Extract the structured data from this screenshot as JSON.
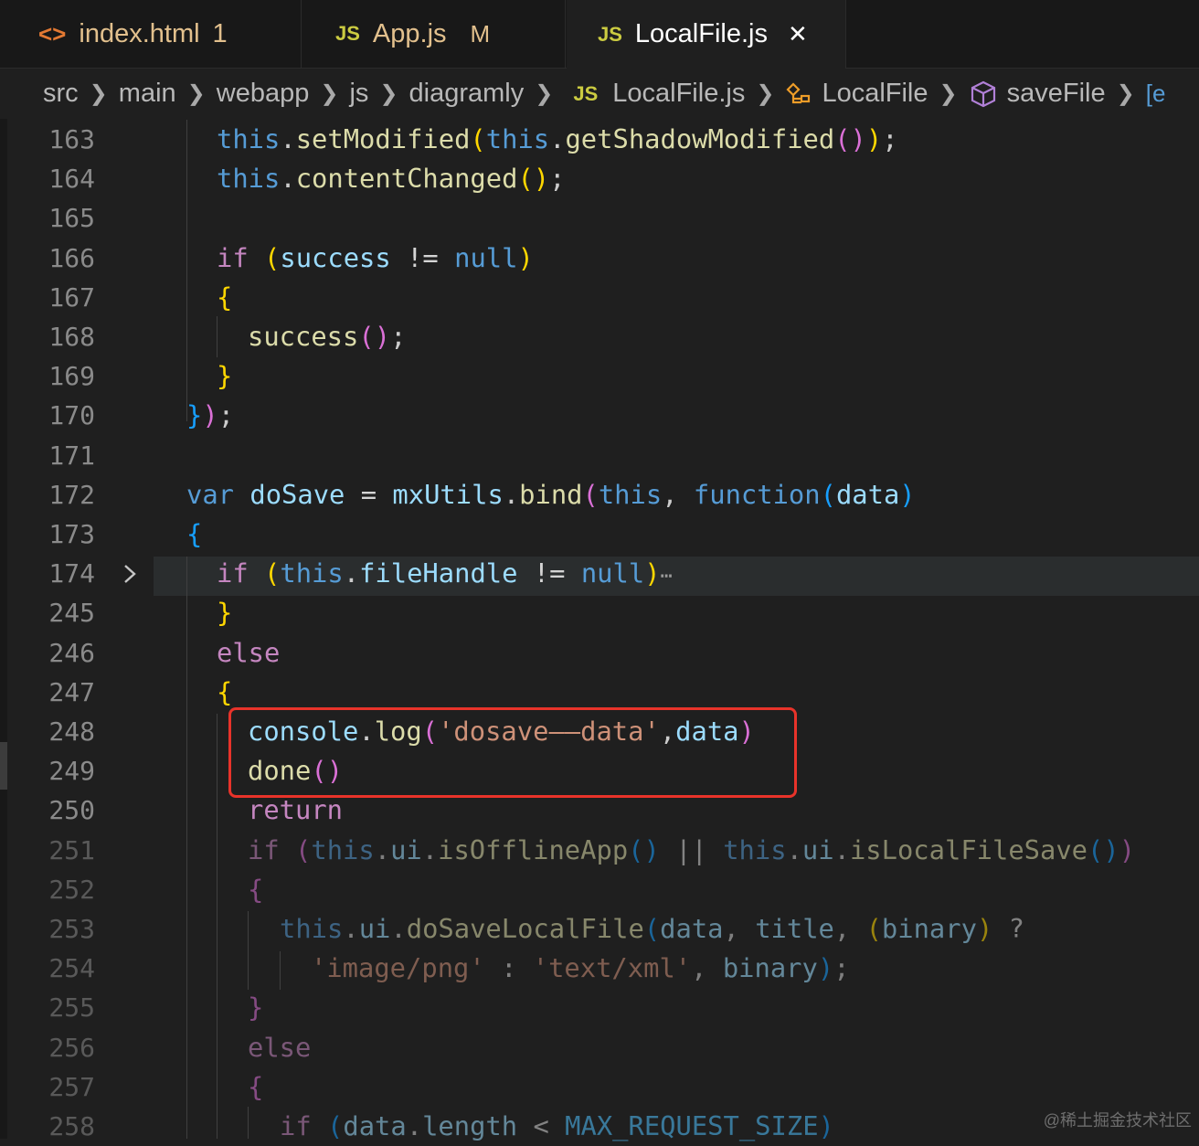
{
  "tabs": [
    {
      "icon": "<>",
      "label": "index.html",
      "badge": "1"
    },
    {
      "icon": "JS",
      "label": "App.js",
      "badge": "M"
    },
    {
      "icon": "JS",
      "label": "LocalFile.js",
      "close": "✕"
    }
  ],
  "breadcrumb": [
    "src",
    "main",
    "webapp",
    "js",
    "diagramly",
    "LocalFile.js",
    "LocalFile",
    "saveFile"
  ],
  "breadcrumb_js_icon": "JS",
  "lines": {
    "l163": "163",
    "l164": "164",
    "l165": "165",
    "l166": "166",
    "l167": "167",
    "l168": "168",
    "l169": "169",
    "l170": "170",
    "l171": "171",
    "l172": "172",
    "l173": "173",
    "l174": "174",
    "l245": "245",
    "l246": "246",
    "l247": "247",
    "l248": "248",
    "l249": "249",
    "l250": "250",
    "l251": "251",
    "l252": "252",
    "l253": "253",
    "l254": "254",
    "l255": "255",
    "l256": "256",
    "l257": "257",
    "l258": "258"
  },
  "code": {
    "t_this": "this",
    "t_setModified": "setModified",
    "t_getShadowModified": "getShadowModified",
    "t_contentChanged": "contentChanged",
    "t_if": "if",
    "t_success": "success",
    "t_null": "null",
    "t_var": "var",
    "t_doSave": "doSave",
    "t_mxUtils": "mxUtils",
    "t_bind": "bind",
    "t_function": "function",
    "t_data": "data",
    "t_fileHandle": "fileHandle",
    "t_else": "else",
    "t_console": "console",
    "t_log": "log",
    "t_dosave_str": "'dosave——data'",
    "t_done": "done",
    "t_return": "return",
    "t_ui": "ui",
    "t_isOfflineApp": "isOfflineApp",
    "t_isLocalFileSave": "isLocalFileSave",
    "t_doSaveLocalFile": "doSaveLocalFile",
    "t_title": "title",
    "t_binary": "binary",
    "t_png": "'image/png'",
    "t_xml": "'text/xml'",
    "t_length": "length",
    "t_MAX": "MAX_REQUEST_SIZE",
    "t_fold": "⋯"
  },
  "watermark": "@稀土掘金技术社区",
  "colors": {
    "keyword": "#569cd6",
    "control": "#c586c0",
    "function": "#dcdcaa",
    "variable": "#9cdcfe",
    "string": "#ce9178",
    "highlight_box": "#e8332a"
  }
}
